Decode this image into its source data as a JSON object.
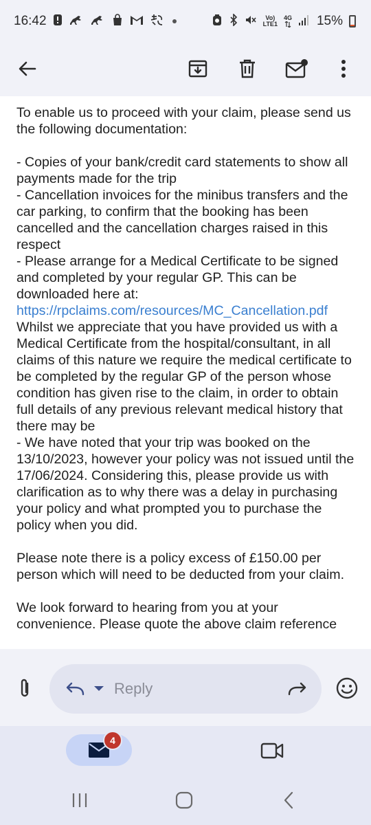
{
  "status_bar": {
    "time": "16:42",
    "network_top": "Vo)",
    "network_bottom": "LTE1",
    "network_type": "4G",
    "battery_percent": "15%",
    "battery_level": 0.15,
    "icons": [
      "alert-icon",
      "horse-icon",
      "horse-icon",
      "shopping-bag-icon",
      "gmail-icon",
      "chinese-char-icon",
      "dot-icon",
      "alarm-icon",
      "bluetooth-icon",
      "mute-icon",
      "signal-icon",
      "battery-icon"
    ]
  },
  "toolbar": {
    "icons": [
      "back-arrow-icon",
      "archive-icon",
      "delete-icon",
      "mark-unread-icon",
      "more-vert-icon"
    ]
  },
  "email": {
    "intro": "To enable us to proceed with your claim, please send us the following documentation:",
    "item1": "- Copies of your bank/credit card statements to show all payments made for the trip",
    "item2": "- Cancellation invoices for the minibus transfers and the car parking, to confirm that the booking has been cancelled and the cancellation charges raised in this respect",
    "item3_before_link": "- Please arrange for a Medical Certificate to be signed and completed by your regular GP. This can be downloaded here at: ",
    "item3_link": "https://rpclaims.com/resources/MC_Cancellation.pdf",
    "item3_after_link": " Whilst we appreciate that you have provided us with a Medical Certificate from the hospital/consultant, in all claims of this nature we require the medical certificate to be completed by the regular GP of the person whose condition has given rise to the claim, in order to obtain full details of any previous relevant medical history that there may be",
    "item4": "- We have noted that your trip was booked on the 13/10/2023, however your policy was not issued until the 17/06/2024. Considering this, please provide us with clarification as to why there was a delay in purchasing your policy and what prompted you to purchase the policy when you did.",
    "excess_note": "Please note there is a policy excess of £150.00 per person which will need to be deducted from your claim.",
    "closing": "We look forward to hearing from you at your convenience. Please quote the above claim reference"
  },
  "reply_bar": {
    "placeholder": "Reply",
    "icons": [
      "attachment-icon",
      "reply-icon",
      "dropdown-icon",
      "forward-icon",
      "emoji-icon"
    ]
  },
  "bottom_nav": {
    "mail_badge": "4",
    "icons": [
      "mail-icon",
      "meet-video-icon"
    ]
  },
  "colors": {
    "background": "#f1f2f8",
    "link": "#3a7fd0",
    "badge": "#c0372d",
    "nav_active": "#c7d4f6"
  }
}
